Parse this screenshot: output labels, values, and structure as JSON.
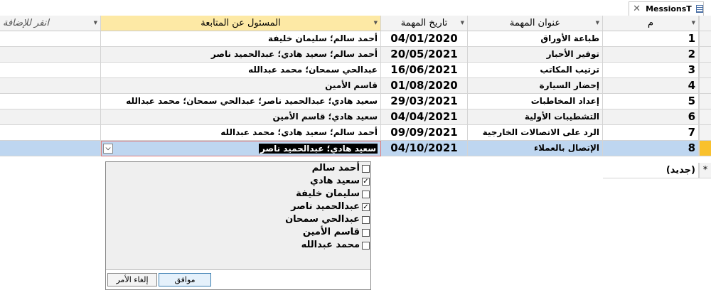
{
  "tab": {
    "title": "MessionsT"
  },
  "columns": {
    "id": "م",
    "task_title": "عنوان المهمة",
    "task_date": "تاريخ المهمة",
    "responsible": "المسئول عن المتابعة",
    "add": "انقر للإضافة"
  },
  "rows": [
    {
      "id": "1",
      "title": "طباعة الأوراق",
      "date": "04/01/2020",
      "resp": "أحمد سالم؛ سليمان خليفة"
    },
    {
      "id": "2",
      "title": "توفير الأحبار",
      "date": "20/05/2021",
      "resp": "أحمد سالم؛ سعيد هادي؛ عبدالحميد ناصر"
    },
    {
      "id": "3",
      "title": "ترتيب المكاتب",
      "date": "16/06/2021",
      "resp": "عبدالحي سمحان؛ محمد عبدالله"
    },
    {
      "id": "4",
      "title": "إحضار السيارة",
      "date": "01/08/2020",
      "resp": "قاسم الأمين"
    },
    {
      "id": "5",
      "title": "إعداد المخاطبات",
      "date": "29/03/2021",
      "resp": "سعيد هادي؛ عبدالحميد ناصر؛ عبدالحي سمحان؛ محمد عبدالله"
    },
    {
      "id": "6",
      "title": "التشطيبات الأولية",
      "date": "04/04/2021",
      "resp": "سعيد هادي؛ قاسم الأمين"
    },
    {
      "id": "7",
      "title": "الرد على الاتصالات الخارجية",
      "date": "09/09/2021",
      "resp": "أحمد سالم؛ سعيد هادي؛ محمد عبدالله"
    },
    {
      "id": "8",
      "title": "الإتصال بالعملاء",
      "date": "04/10/2021",
      "resp": "سعيد هادي؛ عبدالحميد ناصر"
    }
  ],
  "new_row": {
    "marker": "*",
    "label": "(جديد)"
  },
  "dropdown": {
    "items": [
      {
        "label": "أحمد سالم",
        "checked": false,
        "mark": ""
      },
      {
        "label": "سعيد هادي",
        "checked": true,
        "mark": "✓"
      },
      {
        "label": "سليمان خليفة",
        "checked": false,
        "mark": ""
      },
      {
        "label": "عبدالحميد ناصر",
        "checked": true,
        "mark": "✓"
      },
      {
        "label": "عبدالحي سمحان",
        "checked": false,
        "mark": ""
      },
      {
        "label": "قاسم الأمين",
        "checked": false,
        "mark": ""
      },
      {
        "label": "محمد عبدالله",
        "checked": false,
        "mark": ""
      }
    ],
    "ok_label": "موافق",
    "cancel_label": "إلغاء الأمر"
  }
}
